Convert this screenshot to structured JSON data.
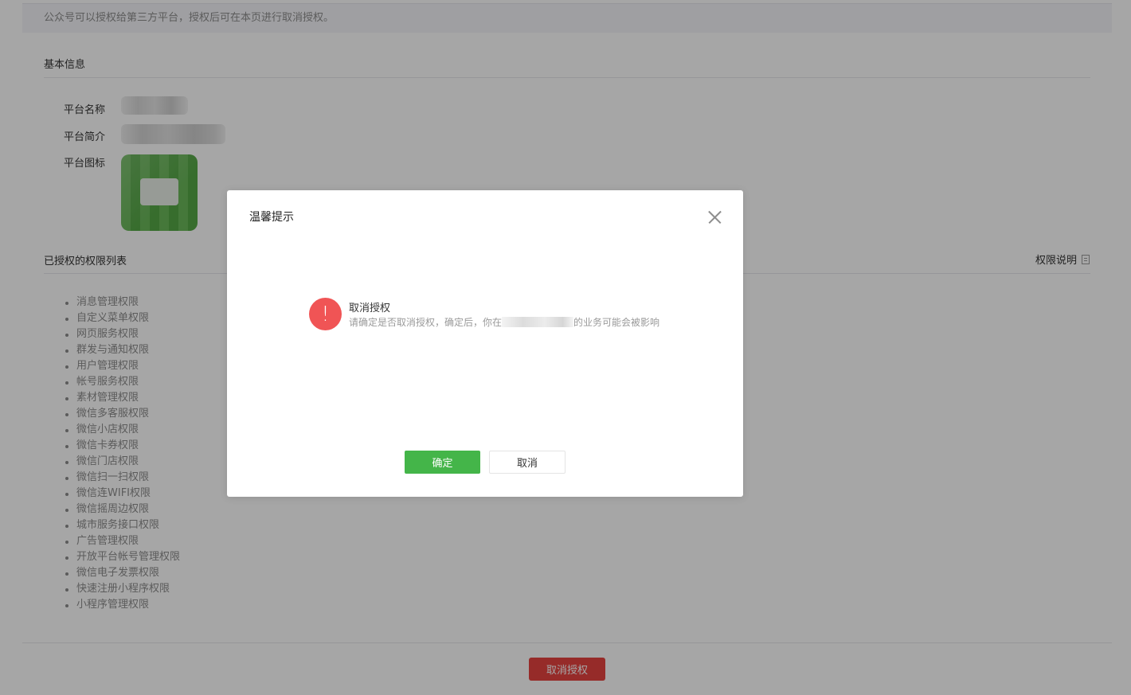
{
  "notice": "公众号可以授权给第三方平台，授权后可在本页进行取消授权。",
  "basic_info": {
    "title": "基本信息",
    "name_label": "平台名称",
    "intro_label": "平台简介",
    "icon_label": "平台图标"
  },
  "permissions": {
    "title": "已授权的权限列表",
    "help_label": "权限说明",
    "items": [
      "消息管理权限",
      "自定义菜单权限",
      "网页服务权限",
      "群发与通知权限",
      "用户管理权限",
      "帐号服务权限",
      "素材管理权限",
      "微信多客服权限",
      "微信小店权限",
      "微信卡券权限",
      "微信门店权限",
      "微信扫一扫权限",
      "微信连WIFI权限",
      "微信摇周边权限",
      "城市服务接口权限",
      "广告管理权限",
      "开放平台帐号管理权限",
      "微信电子发票权限",
      "快速注册小程序权限",
      "小程序管理权限"
    ]
  },
  "footer": {
    "revoke_label": "取消授权"
  },
  "dialog": {
    "title": "温馨提示",
    "icon": "warning-icon",
    "message_title": "取消授权",
    "message_prefix": "请确定是否取消授权，确定后，你在",
    "message_suffix": "的业务可能会被影响",
    "confirm_label": "确定",
    "cancel_label": "取消"
  },
  "colors": {
    "primary": "#44b549",
    "danger": "#e64340",
    "warning": "#f05455"
  }
}
